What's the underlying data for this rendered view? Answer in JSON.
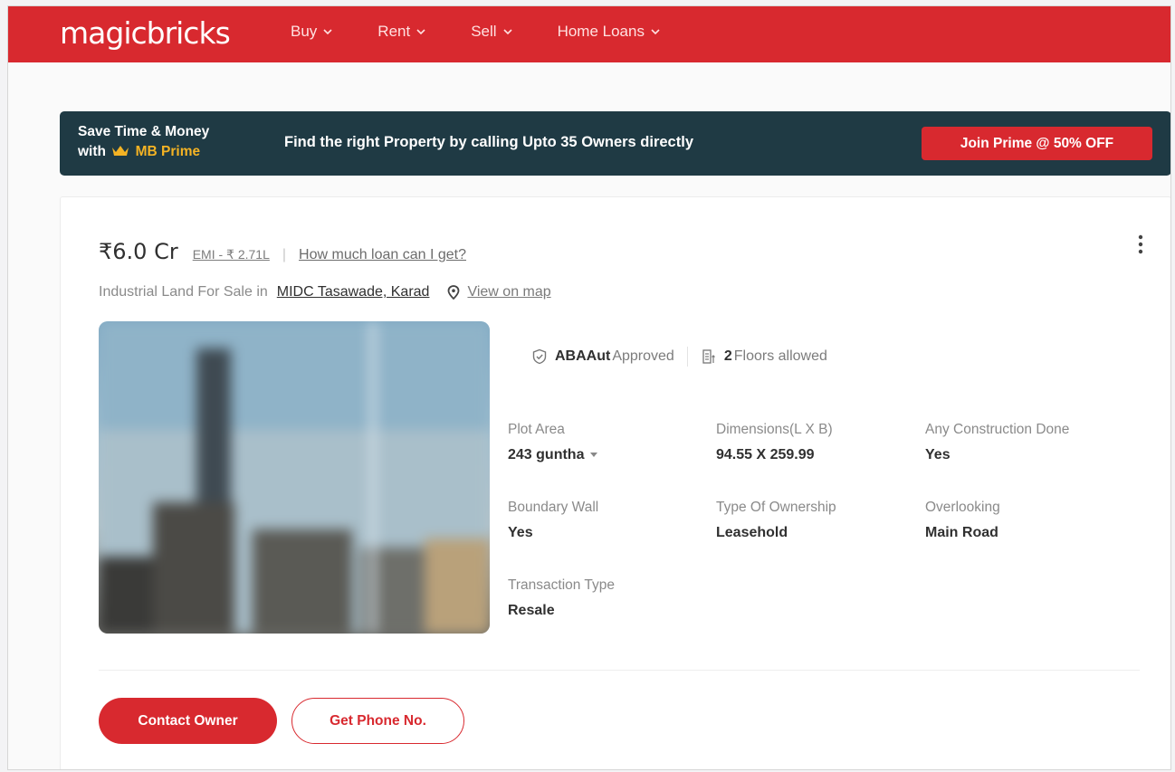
{
  "header": {
    "logo": "magicbricks",
    "nav": [
      {
        "label": "Buy"
      },
      {
        "label": "Rent"
      },
      {
        "label": "Sell"
      },
      {
        "label": "Home Loans"
      }
    ]
  },
  "prime_banner": {
    "line1": "Save Time & Money",
    "line2_prefix": "with",
    "brand": "MB Prime",
    "message": "Find the right Property by calling Upto 35 Owners directly",
    "cta": "Join Prime @ 50% OFF"
  },
  "listing": {
    "price": "₹6.0 Cr",
    "emi": "EMI - ₹ 2.71L",
    "separator": "|",
    "loan_link": "How much loan can I get?",
    "location_label": "Industrial Land For Sale in",
    "location": "MIDC Tasawade, Karad",
    "map_link": "View on map",
    "badges": {
      "approval_bold": "ABAAut",
      "approval_text": "Approved",
      "floors_bold": "2",
      "floors_text": "Floors allowed"
    },
    "specs": [
      {
        "label": "Plot Area",
        "value": "243 guntha"
      },
      {
        "label": "Dimensions(L X B)",
        "value": "94.55 X 259.99"
      },
      {
        "label": "Any Construction Done",
        "value": "Yes"
      },
      {
        "label": "Boundary Wall",
        "value": "Yes"
      },
      {
        "label": "Type Of Ownership",
        "value": "Leasehold"
      },
      {
        "label": "Overlooking",
        "value": "Main Road"
      },
      {
        "label": "Transaction Type",
        "value": "Resale"
      }
    ],
    "actions": {
      "contact": "Contact Owner",
      "phone": "Get Phone No."
    }
  },
  "colors": {
    "brand_red": "#d8292f",
    "banner_bg": "#1f3a44",
    "prime_gold": "#f4b324"
  }
}
